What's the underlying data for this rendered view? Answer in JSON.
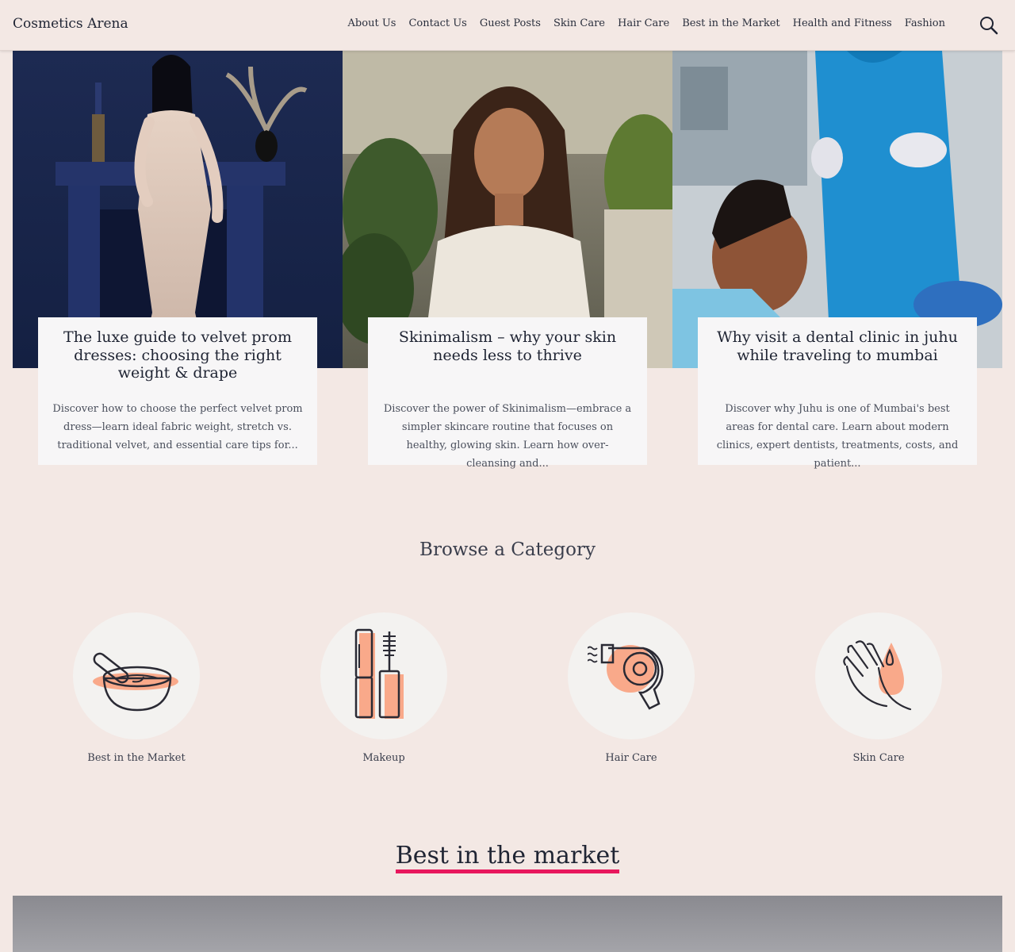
{
  "header": {
    "site_title": "Cosmetics Arena",
    "nav": [
      "About Us",
      "Contact Us",
      "Guest Posts",
      "Skin Care",
      "Hair Care",
      "Best in the Market",
      "Health and Fitness",
      "Fashion"
    ],
    "search_icon": "search-icon"
  },
  "featured": [
    {
      "title": "The luxe guide to velvet prom dresses: choosing the right weight & drape",
      "excerpt": "Discover how to choose the perfect velvet prom dress—learn ideal fabric weight, stretch vs. traditional velvet, and essential care tips for..."
    },
    {
      "title": "Skinimalism – why your skin needs less to thrive",
      "excerpt": "Discover the power of Skinimalism—embrace a simpler skincare routine that focuses on healthy, glowing skin. Learn how over-cleansing and..."
    },
    {
      "title": "Why visit a dental clinic in juhu while traveling to mumbai",
      "excerpt": "Discover why Juhu is one of Mumbai's best areas for dental care. Learn about modern clinics, expert dentists, treatments, costs, and patient..."
    }
  ],
  "browse": {
    "title": "Browse a Category",
    "categories": [
      {
        "label": "Best in the Market",
        "icon": "mortar-bowl-icon"
      },
      {
        "label": "Makeup",
        "icon": "mascara-lipstick-icon"
      },
      {
        "label": "Hair Care",
        "icon": "hair-dryer-icon"
      },
      {
        "label": "Skin Care",
        "icon": "hand-drop-icon"
      }
    ]
  },
  "best": {
    "title": "Best in the market"
  },
  "colors": {
    "background": "#f3e8e4",
    "card": "#f7f6f7",
    "accent_underline": "#e8175d",
    "icon_accent": "#f9a98a",
    "text_dark": "#1f2433"
  }
}
